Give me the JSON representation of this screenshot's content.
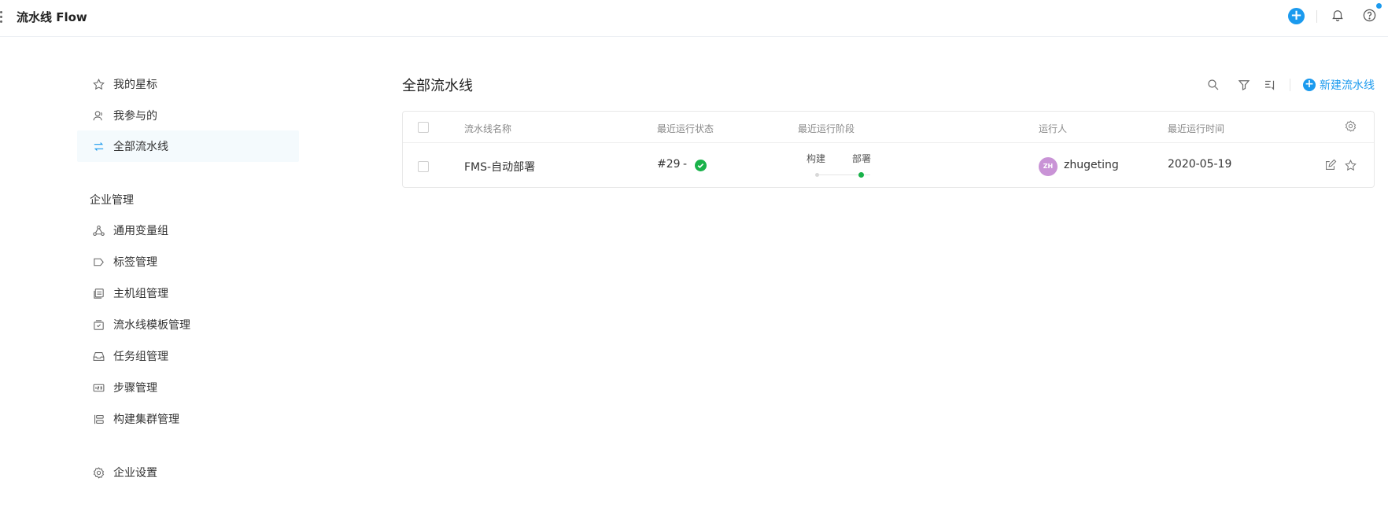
{
  "header": {
    "app_title": "流水线 Flow",
    "add_icon": "plus-circle-icon",
    "bell_icon": "bell-icon",
    "help_icon": "help-circle-icon",
    "accent_color": "#1b9aee"
  },
  "sidebar": {
    "items": [
      {
        "label": "我的星标",
        "icon": "star-icon"
      },
      {
        "label": "我参与的",
        "icon": "user-icon"
      },
      {
        "label": "全部流水线",
        "icon": "swap-icon",
        "active": true
      }
    ],
    "group_title": "企业管理",
    "group_items": [
      {
        "label": "通用变量组",
        "icon": "share-nodes-icon"
      },
      {
        "label": "标签管理",
        "icon": "tag-icon"
      },
      {
        "label": "主机组管理",
        "icon": "server-icon"
      },
      {
        "label": "流水线模板管理",
        "icon": "template-icon"
      },
      {
        "label": "任务组管理",
        "icon": "inbox-icon"
      },
      {
        "label": "步骤管理",
        "icon": "steps-icon"
      },
      {
        "label": "构建集群管理",
        "icon": "cluster-icon"
      }
    ],
    "settings": {
      "label": "企业设置",
      "icon": "gear-icon"
    }
  },
  "main": {
    "title": "全部流水线",
    "new_button": "新建流水线",
    "table": {
      "columns": [
        "流水线名称",
        "最近运行状态",
        "最近运行阶段",
        "运行人",
        "最近运行时间"
      ],
      "rows": [
        {
          "name": "FMS-自动部署",
          "run_number": "#29",
          "run_sep": "-",
          "status": "success",
          "stages": [
            "构建",
            "部署"
          ],
          "runner_initials": "ZH",
          "runner": "zhugeting",
          "last_run": "2020-05-19"
        }
      ]
    }
  }
}
